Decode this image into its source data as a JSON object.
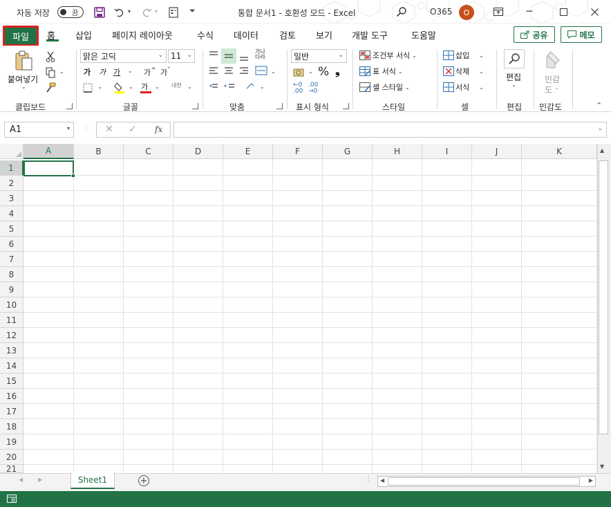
{
  "titlebar": {
    "autosave_label": "자동 저장",
    "autosave_state": "끔",
    "doc_title": "통합 문서1  -  호환성 모드  -  Excel",
    "account": "O365",
    "avatar_initial": "O"
  },
  "tabs": {
    "file": "파일",
    "home": "홈",
    "insert": "삽입",
    "page_layout": "페이지 레이아웃",
    "formulas": "수식",
    "data": "데이터",
    "review": "검토",
    "view": "보기",
    "developer": "개발 도구",
    "help": "도움말",
    "share": "공유",
    "comments": "메모"
  },
  "ribbon": {
    "clipboard": {
      "label": "클립보드",
      "paste": "붙여넣기"
    },
    "font": {
      "label": "글꼴",
      "font_name": "맑은 고딕",
      "font_size": "11",
      "bold": "가",
      "italic": "가",
      "underline": "가",
      "grow": "가",
      "shrink": "가",
      "color_letter": "가",
      "phonetic": "내천"
    },
    "alignment": {
      "label": "맞춤"
    },
    "number": {
      "label": "표시 형식",
      "format": "일반",
      "percent": "%",
      "comma": "❟"
    },
    "styles": {
      "label": "스타일",
      "conditional": "조건부 서식",
      "table": "표 서식",
      "cell_styles": "셀 스타일"
    },
    "cells": {
      "label": "셀",
      "insert": "삽입",
      "delete": "삭제",
      "format": "서식"
    },
    "editing": {
      "label": "편집"
    },
    "sensitivity": {
      "label": "민감도",
      "button_line1": "민감",
      "button_line2": "도"
    }
  },
  "formula_bar": {
    "name_box": "A1",
    "fx": "fx",
    "value": ""
  },
  "grid": {
    "columns": [
      "A",
      "B",
      "C",
      "D",
      "E",
      "F",
      "G",
      "H",
      "I",
      "J",
      "K"
    ],
    "rows": [
      "1",
      "2",
      "3",
      "4",
      "5",
      "6",
      "7",
      "8",
      "9",
      "10",
      "11",
      "12",
      "13",
      "14",
      "15",
      "16",
      "17",
      "18",
      "19",
      "20",
      "21"
    ],
    "active_cell": "A1"
  },
  "sheets": {
    "tabs": [
      "Sheet1"
    ],
    "add": "+"
  },
  "colors": {
    "accent": "#217346",
    "highlight_red": "#e02020",
    "avatar": "#c6501a"
  }
}
